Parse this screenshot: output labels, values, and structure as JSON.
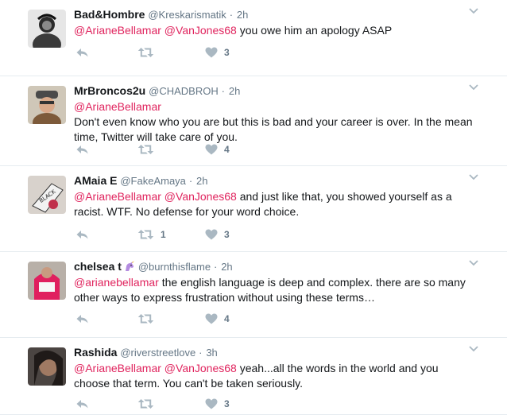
{
  "tweets": [
    {
      "fullname": "Bad&Hombre",
      "username": "@Kreskarismatik",
      "time": "2h",
      "segments": [
        {
          "text": "@ArianeBellamar @VanJones68",
          "mention": true
        },
        {
          "text": " you owe him an apology ASAP",
          "mention": false
        }
      ],
      "reply_count": "",
      "retweet_count": "",
      "like_count": "3"
    },
    {
      "fullname": "MrBroncos2u",
      "username": "@CHADBROH",
      "time": "2h",
      "segments": [
        {
          "text": "@ArianeBellamar",
          "mention": true
        },
        {
          "text": "\nDon't even know who you are but this is bad and your career is over. In the mean time, Twitter will take care of you.",
          "mention": false
        }
      ],
      "reply_count": "",
      "retweet_count": "",
      "like_count": "4"
    },
    {
      "fullname": "AMaia E",
      "username": "@FakeAmaya",
      "time": "2h",
      "segments": [
        {
          "text": "@ArianeBellamar @VanJones68",
          "mention": true
        },
        {
          "text": " and just like that, you showed yourself as a racist. WTF. No defense for your word choice.",
          "mention": false
        }
      ],
      "reply_count": "",
      "retweet_count": "1",
      "like_count": "3"
    },
    {
      "fullname": "chelsea t",
      "username": "@burnthisflame",
      "time": "2h",
      "segments": [
        {
          "text": "@arianebellamar",
          "mention": true
        },
        {
          "text": " the english language is deep and complex. there are so many other ways to express frustration without using these terms…",
          "mention": false
        }
      ],
      "reply_count": "",
      "retweet_count": "",
      "like_count": "4"
    },
    {
      "fullname": "Rashida",
      "username": "@riverstreetlove",
      "time": "3h",
      "segments": [
        {
          "text": "@ArianeBellamar @VanJones68",
          "mention": true
        },
        {
          "text": " yeah...all the words in the world and you choose that term. You can't be taken seriously.",
          "mention": false
        }
      ],
      "reply_count": "",
      "retweet_count": "",
      "like_count": "3"
    }
  ],
  "ui": {
    "separator": "·",
    "emoji_after_name": "unicorn-emoji",
    "mention_color": "#e0245e",
    "meta_color": "#657786",
    "icon_color": "#aab8c2"
  }
}
